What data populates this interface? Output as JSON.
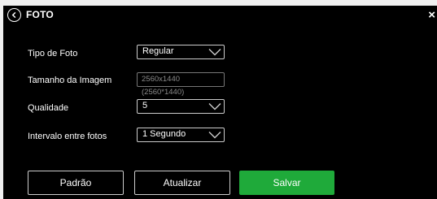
{
  "header": {
    "title": "FOTO",
    "back_icon": "back-circle-icon",
    "close_label": "×"
  },
  "form": {
    "photo_type": {
      "label": "Tipo de Foto",
      "value": "Regular"
    },
    "image_size": {
      "label": "Tamanho da Imagem",
      "value": "2560x1440 (2560*1440)"
    },
    "quality": {
      "label": "Qualidade",
      "value": "5"
    },
    "interval": {
      "label": "Intervalo entre fotos",
      "value": "1 Segundo"
    }
  },
  "buttons": {
    "default_label": "Padrão",
    "refresh_label": "Atualizar",
    "save_label": "Salvar"
  },
  "colors": {
    "background": "#000000",
    "accent": "#1faa3a",
    "text": "#ffffff"
  }
}
